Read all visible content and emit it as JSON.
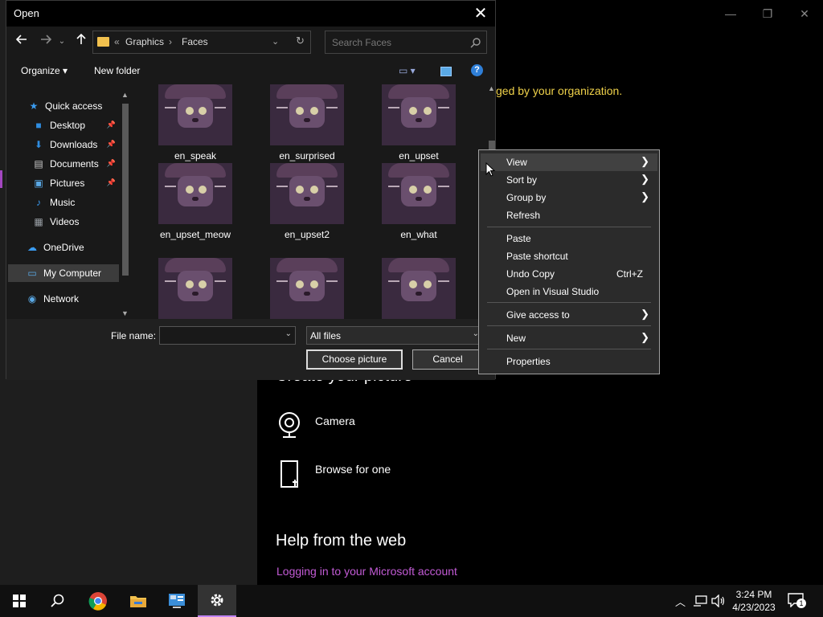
{
  "background": {
    "managed_text": "ged by your organization.",
    "create_heading": "Create your picture",
    "options": [
      {
        "label": "Camera",
        "icon": "camera-icon"
      },
      {
        "label": "Browse for one",
        "icon": "file-icon"
      }
    ],
    "help_heading": "Help from the web",
    "help_link": "Logging in to your Microsoft account",
    "window_controls": {
      "minimize": "—",
      "maximize": "❐",
      "close": "✕"
    }
  },
  "dialog": {
    "title": "Open",
    "close_glyph": "✕",
    "breadcrumb": {
      "chevron": "«",
      "folder1": "Graphics",
      "separator": "›",
      "folder2": "Faces"
    },
    "search_placeholder": "Search Faces",
    "toolbar": {
      "organize": "Organize ▾",
      "new_folder": "New folder"
    },
    "sidebar": [
      {
        "label": "Quick access",
        "icon": "star-icon",
        "glyph": "★",
        "color": "#3a9bf0",
        "pinned": false
      },
      {
        "label": "Desktop",
        "icon": "desktop-icon",
        "glyph": "■",
        "color": "#2f8de0",
        "pinned": true
      },
      {
        "label": "Downloads",
        "icon": "download-icon",
        "glyph": "⬇",
        "color": "#2f8de0",
        "pinned": true
      },
      {
        "label": "Documents",
        "icon": "documents-icon",
        "glyph": "▤",
        "color": "#cccccc",
        "pinned": true
      },
      {
        "label": "Pictures",
        "icon": "pictures-icon",
        "glyph": "▣",
        "color": "#5aa9e6",
        "pinned": true
      },
      {
        "label": "Music",
        "icon": "music-icon",
        "glyph": "♪",
        "color": "#3a9bf0",
        "pinned": false
      },
      {
        "label": "Videos",
        "icon": "videos-icon",
        "glyph": "▦",
        "color": "#9aa0a6",
        "pinned": false
      },
      {
        "label": "OneDrive",
        "icon": "onedrive-icon",
        "glyph": "☁",
        "color": "#3a9bf0",
        "pinned": false
      },
      {
        "label": "My Computer",
        "icon": "computer-icon",
        "glyph": "▭",
        "color": "#5aa9e6",
        "pinned": false
      },
      {
        "label": "Network",
        "icon": "network-icon",
        "glyph": "◉",
        "color": "#5aa9e6",
        "pinned": false
      }
    ],
    "files": [
      {
        "name": "en_speak"
      },
      {
        "name": "en_surprised"
      },
      {
        "name": "en_upset"
      },
      {
        "name": "en_upset_meow"
      },
      {
        "name": "en_upset2"
      },
      {
        "name": "en_what"
      },
      {
        "name": ""
      },
      {
        "name": ""
      },
      {
        "name": ""
      }
    ],
    "file_name_label": "File name:",
    "file_name_value": "",
    "file_type": "All files",
    "choose_button": "Choose picture",
    "cancel_button": "Cancel"
  },
  "context_menu": [
    {
      "label": "View",
      "submenu": true,
      "shortcut": ""
    },
    {
      "label": "Sort by",
      "submenu": true,
      "shortcut": ""
    },
    {
      "label": "Group by",
      "submenu": true,
      "shortcut": ""
    },
    {
      "label": "Refresh",
      "submenu": false,
      "shortcut": ""
    },
    {
      "label": "Paste",
      "submenu": false,
      "shortcut": ""
    },
    {
      "label": "Paste shortcut",
      "submenu": false,
      "shortcut": ""
    },
    {
      "label": "Undo Copy",
      "submenu": false,
      "shortcut": "Ctrl+Z"
    },
    {
      "label": "Open in Visual Studio",
      "submenu": false,
      "shortcut": ""
    },
    {
      "label": "Give access to",
      "submenu": true,
      "shortcut": ""
    },
    {
      "label": "New",
      "submenu": true,
      "shortcut": ""
    },
    {
      "label": "Properties",
      "submenu": false,
      "shortcut": ""
    }
  ],
  "taskbar": {
    "time": "3:24 PM",
    "date": "4/23/2023",
    "notification_count": "1",
    "accent": "#c084f5"
  }
}
